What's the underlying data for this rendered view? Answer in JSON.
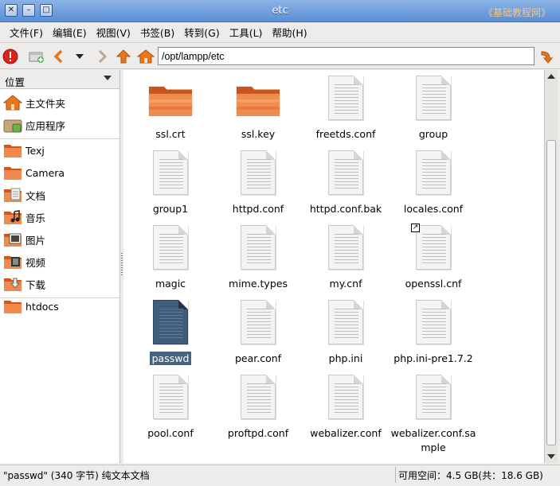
{
  "window": {
    "title": "etc",
    "watermark": "《基础教程网》",
    "buttons": {
      "close": "✕",
      "minimize": "–",
      "maximize": "□"
    }
  },
  "menu": [
    "文件(F)",
    "编辑(E)",
    "视图(V)",
    "书签(B)",
    "转到(G)",
    "工具(L)",
    "帮助(H)"
  ],
  "toolbar": {
    "location_value": "/opt/lampp/etc"
  },
  "sidebar": {
    "header": "位置",
    "items": [
      {
        "label": "主文件夹",
        "icon": "home-folder-icon"
      },
      {
        "label": "应用程序",
        "icon": "applications-folder-icon"
      },
      {
        "label": "Texj",
        "icon": "folder-icon"
      },
      {
        "label": "Camera",
        "icon": "folder-icon"
      },
      {
        "label": "文档",
        "icon": "documents-folder-icon"
      },
      {
        "label": "音乐",
        "icon": "music-folder-icon"
      },
      {
        "label": "图片",
        "icon": "pictures-folder-icon"
      },
      {
        "label": "视频",
        "icon": "videos-folder-icon"
      },
      {
        "label": "下载",
        "icon": "downloads-folder-icon"
      },
      {
        "label": "htdocs",
        "icon": "folder-icon"
      }
    ]
  },
  "files": [
    {
      "name": "ssl.crt",
      "type": "folder"
    },
    {
      "name": "ssl.key",
      "type": "folder"
    },
    {
      "name": "freetds.conf",
      "type": "doc"
    },
    {
      "name": "group",
      "type": "doc"
    },
    {
      "name": "group1",
      "type": "doc"
    },
    {
      "name": "httpd.conf",
      "type": "doc"
    },
    {
      "name": "httpd.conf.bak",
      "type": "doc"
    },
    {
      "name": "locales.conf",
      "type": "doc"
    },
    {
      "name": "magic",
      "type": "doc"
    },
    {
      "name": "mime.types",
      "type": "doc"
    },
    {
      "name": "my.cnf",
      "type": "doc"
    },
    {
      "name": "openssl.cnf",
      "type": "doc-link"
    },
    {
      "name": "passwd",
      "type": "doc-selected"
    },
    {
      "name": "pear.conf",
      "type": "doc"
    },
    {
      "name": "php.ini",
      "type": "doc"
    },
    {
      "name": "php.ini-pre1.7.2",
      "type": "doc"
    },
    {
      "name": "pool.conf",
      "type": "doc"
    },
    {
      "name": "proftpd.conf",
      "type": "doc"
    },
    {
      "name": "webalizer.conf",
      "type": "doc"
    },
    {
      "name": "webalizer.conf.sa mple",
      "type": "doc"
    }
  ],
  "status": {
    "left": "\"passwd\" (340 字节) 纯文本文档",
    "right": "可用空间：4.5 GB(共：18.6 GB)"
  }
}
